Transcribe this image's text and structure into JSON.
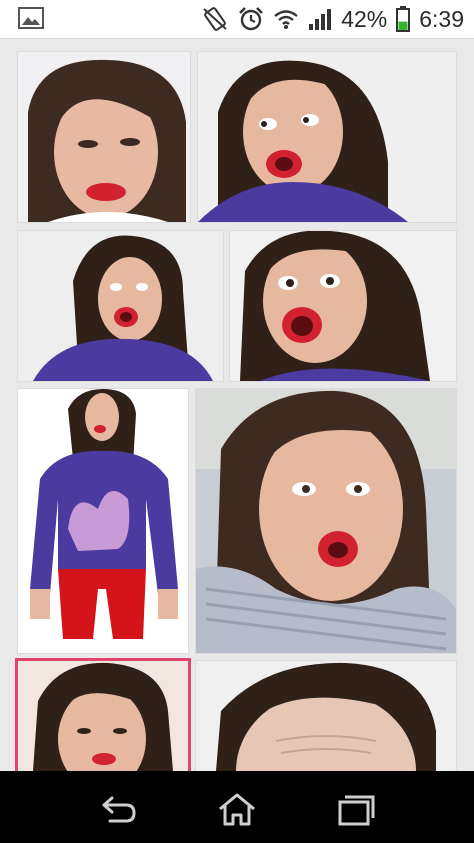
{
  "status_bar": {
    "left_icon": "gallery-picture-icon",
    "icons": [
      "rotation-lock-icon",
      "alarm-clock-icon",
      "wifi-icon",
      "cellular-signal-icon",
      "battery-icon"
    ],
    "battery_percent": "42%",
    "battery_level": 0.42,
    "time": "6:39",
    "battery_color": "#33b32e"
  },
  "gallery": {
    "selected_index": 6,
    "selection_color": "#e0436c",
    "images": [
      {
        "subject": "woman-squinting-red-lips",
        "top": "#3d2b22",
        "bottom": "#f0f0f4"
      },
      {
        "subject": "woman-side-eye-purple-sweater",
        "top": "#2f2018",
        "bottom": "#4b3aa0"
      },
      {
        "subject": "woman-screaming-purple-sweater",
        "top": "#2f2018",
        "bottom": "#4b3aa0"
      },
      {
        "subject": "woman-shocked-closeup",
        "top": "#2f2018",
        "bottom": "#4b3aa0"
      },
      {
        "subject": "woman-cat-sweater-red-pants",
        "top": "#2f2018",
        "bottom": "#d5131a"
      },
      {
        "subject": "woman-striped-shirt-pout",
        "top": "#3d2b22",
        "bottom": "#b7bccb"
      },
      {
        "subject": "woman-frowning-cropped",
        "top": "#2f2018",
        "bottom": "#f2e6e0"
      },
      {
        "subject": "woman-forehead-closeup",
        "top": "#2f2018",
        "bottom": "#e6c7b6"
      }
    ]
  },
  "nav_bar": {
    "back_icon": "back-arrow-icon",
    "home_icon": "home-icon",
    "recents_icon": "recent-apps-icon"
  }
}
